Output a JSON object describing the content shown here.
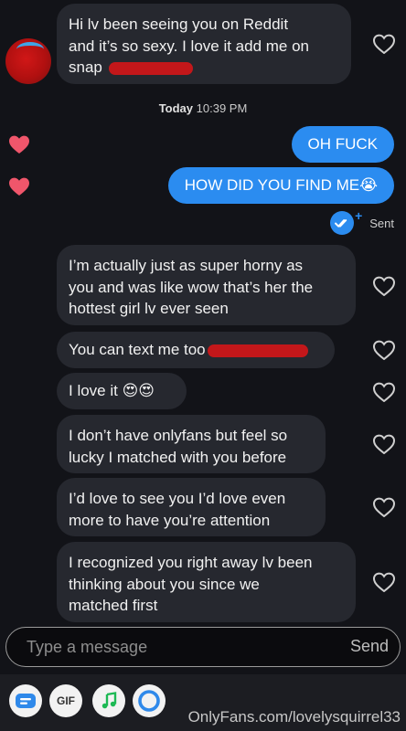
{
  "messages": {
    "incoming_first": {
      "line1": "Hi lv been seeing you on Reddit",
      "line2": "and it’s so sexy. I love it add me on",
      "line3": "snap"
    },
    "timestamp": {
      "day": "Today",
      "time": "10:39 PM"
    },
    "outgoing": [
      "OH FUCK",
      "HOW DID YOU FIND ME😭"
    ],
    "status": "Sent",
    "incoming": [
      {
        "line1": "I’m actually just as super horny as",
        "line2": "you and was like wow that’s her the",
        "line3": "hottest girl lv ever seen"
      },
      {
        "line1": "You can text me too"
      },
      {
        "line1": "I love it 😍😍"
      },
      {
        "line1": "I don’t have onlyfans but feel so",
        "line2": "lucky I matched with you before"
      },
      {
        "line1": "I’d love to see you I’d love even",
        "line2": "more to have you’re attention"
      },
      {
        "line1": "I recognized you right away lv been",
        "line2": "thinking about you since we",
        "line3": "matched first"
      }
    ]
  },
  "composer": {
    "placeholder": "Type a message",
    "send_label": "Send"
  },
  "toolbar": {
    "gif_label": "GIF"
  },
  "watermark": "OnlyFans.com/lovelysquirrel33",
  "colors": {
    "accent": "#2b8cf0",
    "incoming_bubble": "#26282f",
    "heart": "#f0566b",
    "background": "#121318"
  },
  "icons": [
    "heart-outline-icon",
    "heart-filled-icon",
    "double-check-icon",
    "sticker-icon",
    "gif-icon",
    "music-icon",
    "circle-icon"
  ]
}
